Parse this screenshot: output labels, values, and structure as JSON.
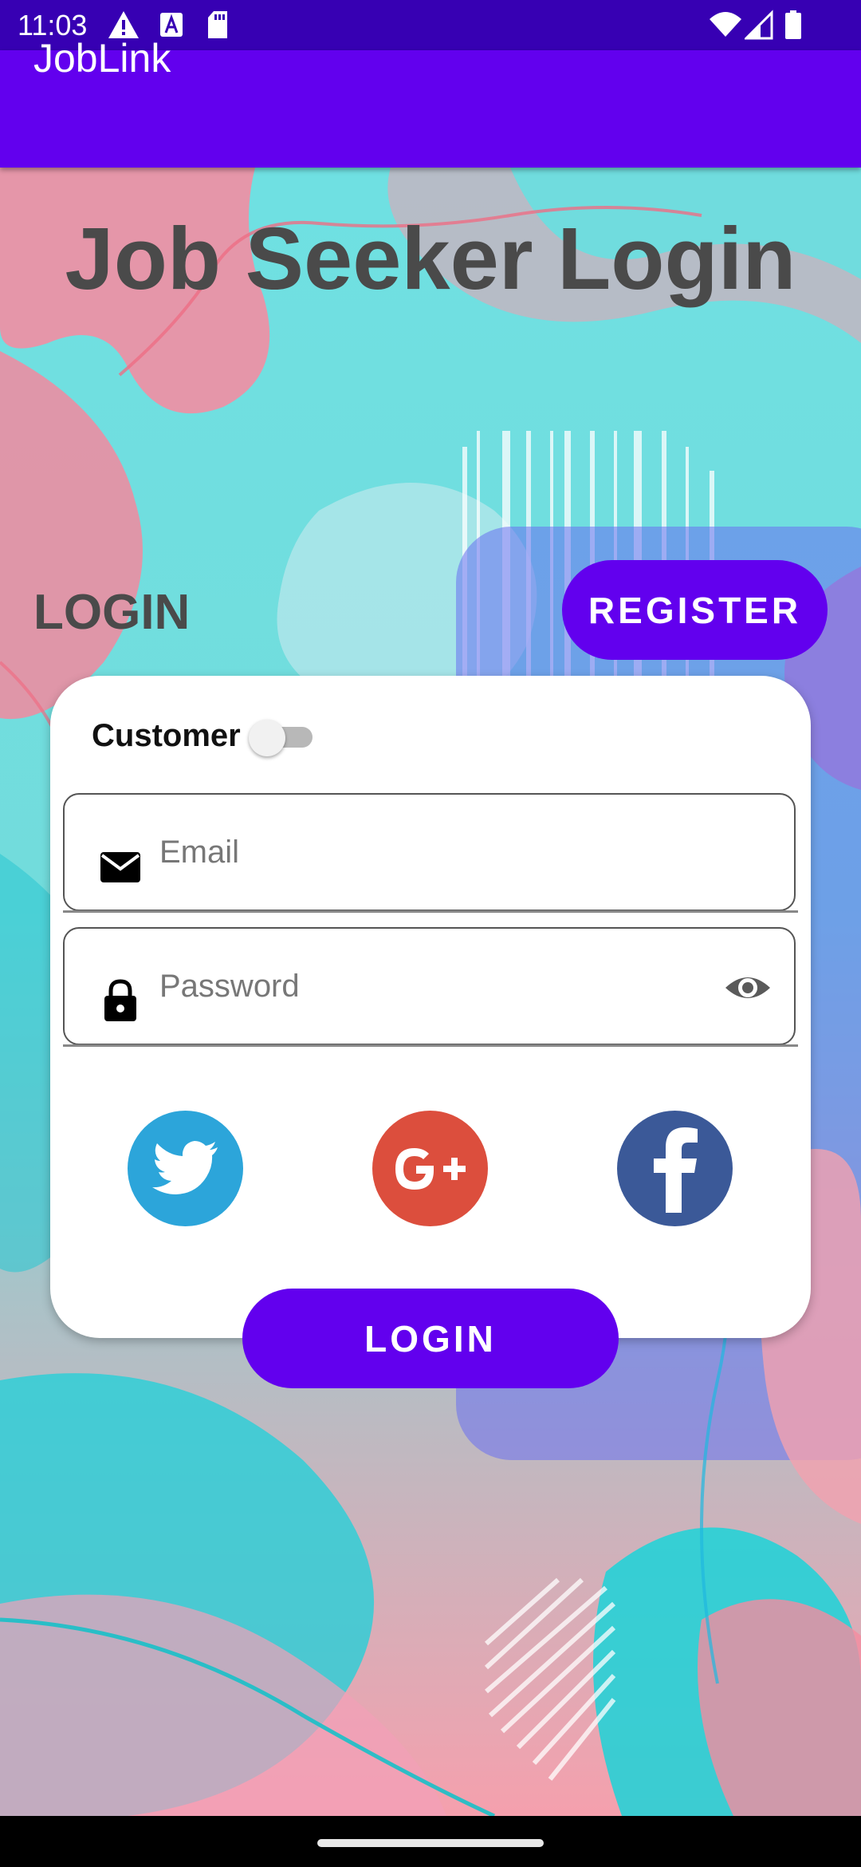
{
  "status_bar": {
    "time": "11:03",
    "icons": [
      "warning-icon",
      "font-a-icon",
      "sd-card-icon",
      "wifi-icon",
      "signal-icon",
      "battery-icon"
    ]
  },
  "app_bar": {
    "title": "JobLink"
  },
  "page": {
    "title": "Job Seeker Login"
  },
  "tabs": {
    "login_label": "LOGIN",
    "register_label": "REGISTER"
  },
  "form": {
    "role_label": "Customer",
    "role_switch_on": false,
    "email": {
      "placeholder": "Email",
      "value": ""
    },
    "password": {
      "placeholder": "Password",
      "value": ""
    },
    "social": [
      "twitter-icon",
      "google-plus-icon",
      "facebook-icon"
    ],
    "login_label": "LOGIN"
  },
  "colors": {
    "primary": "#6200ee",
    "status_bar": "#3700b3",
    "twitter": "#2ca5da",
    "google_plus": "#dc4e3d",
    "facebook": "#3b5998"
  }
}
